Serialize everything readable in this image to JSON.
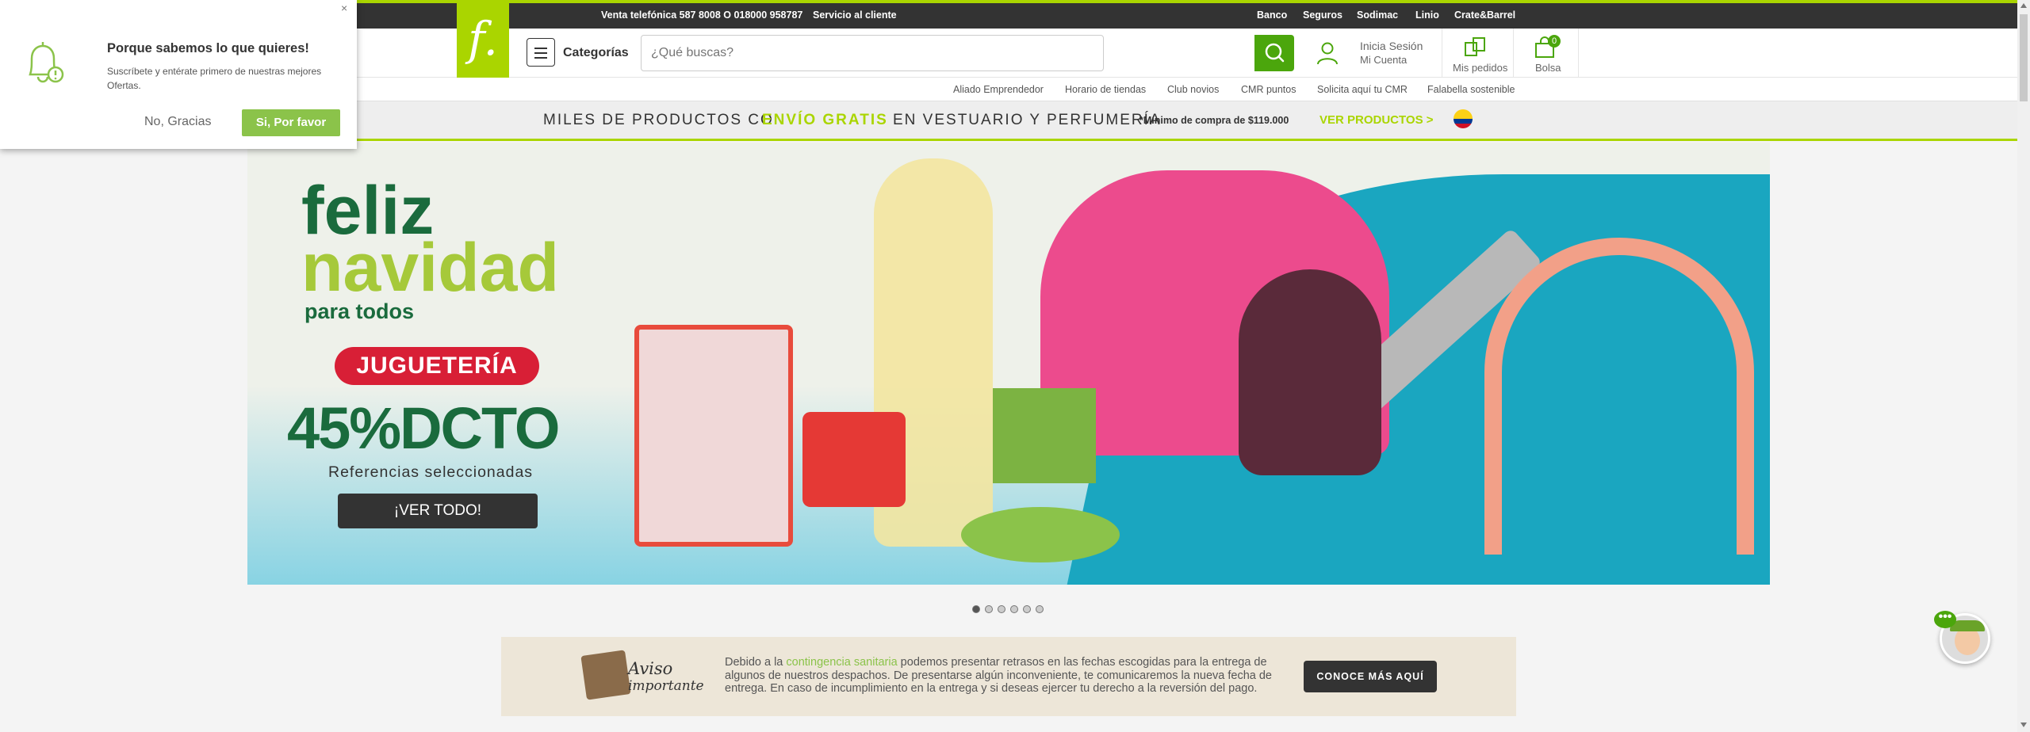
{
  "topbar": {
    "phone": "Venta telefónica 587 8008 O 018000 958787",
    "service": "Servicio al cliente",
    "links": [
      "Banco",
      "Seguros",
      "Sodimac",
      "Linio",
      "Crate&Barrel"
    ]
  },
  "logo": {
    "text": "f."
  },
  "header": {
    "categories_label": "Categorías",
    "search_placeholder": "¿Qué buscas?",
    "account_line1": "Inicia Sesión",
    "account_line2": "Mi Cuenta",
    "orders_label": "Mis pedidos",
    "bag_label": "Bolsa",
    "bag_count": "0"
  },
  "sublinks": [
    "Aliado Emprendedor",
    "Horario de tiendas",
    "Club novios",
    "CMR puntos",
    "Solicita aquí tu CMR",
    "Falabella sostenible"
  ],
  "promo": {
    "text1": "MILES DE PRODUCTOS CON",
    "text2": "ENVÍO GRATIS",
    "text3": "EN VESTUARIO Y PERFUMERÍA",
    "note": "*Mínimo de compra de $119.000",
    "cta": "VER PRODUCTOS >"
  },
  "banner": {
    "line1": "feliz",
    "line2": "navidad",
    "line3": "para todos",
    "badge": "JUGUETERÍA",
    "discount": "45%DCTO",
    "subtitle": "Referencias seleccionadas",
    "button": "¡VER TODO!"
  },
  "carousel": {
    "dots": 6,
    "active": 0
  },
  "aviso": {
    "title1": "Aviso",
    "title2": "importante",
    "body_pre": "Debido a la ",
    "body_hl": "contingencia sanitaria",
    "body_post": " podemos presentar retrasos en las fechas escogidas para la entrega de algunos de nuestros despachos. De presentarse algún inconveniente, te comunicaremos la nueva fecha de entrega. En caso de incumplimiento en la entrega y si deseas ejercer tu derecho a la reversión del pago.",
    "cta": "CONOCE MÁS AQUÍ"
  },
  "popup": {
    "title": "Porque sabemos lo que quieres!",
    "text": "Suscríbete y entérate primero de nuestras mejores Ofertas.",
    "no_label": "No, Gracias",
    "yes_label": "Si, Por favor",
    "close": "×"
  },
  "chat": {
    "bubble": "•••"
  },
  "colors": {
    "brand": "#aad500",
    "search": "#4ba60c",
    "dark": "#333333",
    "red": "#d81f36"
  }
}
